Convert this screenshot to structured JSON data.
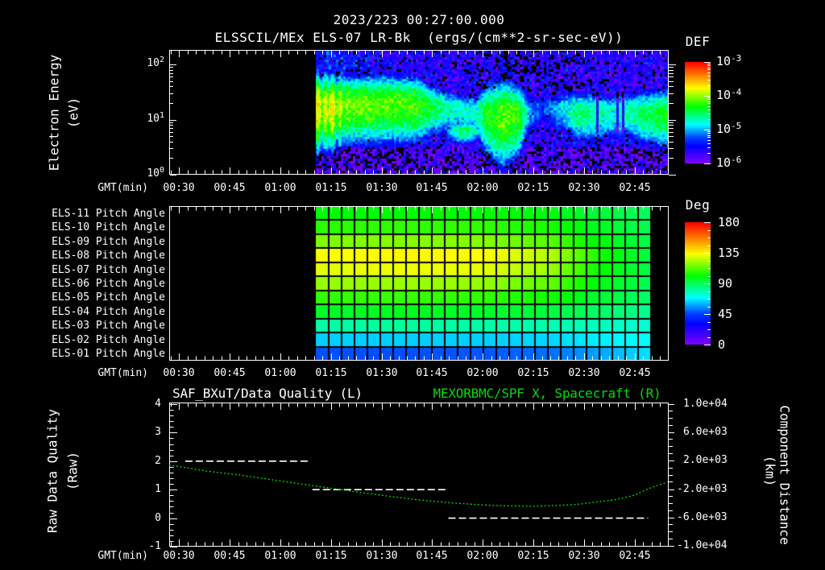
{
  "title": "2023/223 00:27:00.000",
  "subtitle": "ELSSCIL/MEx ELS-07 LR-Bk  (ergs/(cm**2-sr-sec-eV))",
  "colors": {
    "background": "#000000",
    "foreground": "#ffffff",
    "green": "#00dd00"
  },
  "time_axis": {
    "label": "GMT(min)",
    "tick_labels": [
      "00:30",
      "00:45",
      "01:00",
      "01:15",
      "01:30",
      "01:45",
      "02:00",
      "02:15",
      "02:30",
      "02:45"
    ],
    "start_min": 27,
    "end_min": 175.1,
    "major_step_min": 15,
    "minor_step_min": 2.5
  },
  "spectrogram_panel": {
    "ylabel": "Electron Energy",
    "ylabel_units": "(eV)",
    "ytick_exponents": [
      0,
      1,
      2
    ],
    "colorbar": {
      "title": "DEF",
      "tick_exponents": [
        -3,
        -4,
        -5,
        -6
      ]
    }
  },
  "pitch_panel": {
    "row_labels": [
      "ELS-11 Pitch Angle",
      "ELS-10 Pitch Angle",
      "ELS-09 Pitch Angle",
      "ELS-08 Pitch Angle",
      "ELS-07 Pitch Angle",
      "ELS-06 Pitch Angle",
      "ELS-05 Pitch Angle",
      "ELS-04 Pitch Angle",
      "ELS-03 Pitch Angle",
      "ELS-02 Pitch Angle",
      "ELS-01 Pitch Angle"
    ],
    "colorbar": {
      "title": "Deg",
      "ticks": [
        "180",
        "135",
        "90",
        "45",
        "0"
      ]
    }
  },
  "line_panel": {
    "title_left": "SAF_BXuT/Data Quality (L)",
    "title_right": "MEXORBMC/SPF X, Spacecraft (R)",
    "ylabel_left": "Raw Data Quality",
    "ylabel_left_units": "(Raw)",
    "yticks_left": [
      "4",
      "3",
      "2",
      "1",
      "0",
      "-1"
    ],
    "ylabel_right": "Component Distance",
    "ylabel_right_units": "(km)",
    "yticks_right": [
      "1.0e+04",
      "6.0e+03",
      "2.0e+03",
      "-2.0e+03",
      "-6.0e+03",
      "-1.0e+04"
    ]
  },
  "chart_data": [
    {
      "type": "heatmap",
      "name": "electron-energy-spectrogram",
      "x_unit": "GMT(min)",
      "x_range_min": [
        27,
        175.1
      ],
      "data_start_min": 70.5,
      "y_unit": "eV",
      "y_range": [
        1,
        180
      ],
      "y_scale": "log",
      "value_unit": "ergs/(cm**2-sr-sec-eV)",
      "value_range": [
        1e-06,
        0.001
      ],
      "value_scale": "log",
      "band_keyframes_t": [
        70.5,
        75,
        80,
        90,
        100,
        106,
        112,
        118,
        121,
        126,
        131,
        134,
        138,
        144,
        148,
        153,
        158,
        163,
        167,
        172,
        176
      ],
      "band_keyframes_logamp": [
        -3.85,
        -3.9,
        -4.1,
        -4.15,
        -4.2,
        -4.5,
        -4.75,
        -4.75,
        -4.35,
        -4.1,
        -4.25,
        -5.05,
        -5.3,
        -4.85,
        -4.55,
        -4.6,
        -4.75,
        -4.65,
        -4.5,
        -4.4,
        -4.35
      ],
      "band_keyframes_center_log_ev": [
        1.22,
        1.23,
        1.26,
        1.28,
        1.26,
        1.22,
        1.18,
        1.12,
        1.08,
        1.05,
        1.07,
        1.15,
        1.2,
        1.18,
        1.12,
        1.1,
        1.12,
        1.12,
        1.1,
        1.1,
        1.1
      ],
      "band_keyframes_width_log_ev": [
        0.5,
        0.5,
        0.46,
        0.48,
        0.46,
        0.36,
        0.32,
        0.32,
        0.52,
        0.6,
        0.5,
        0.34,
        0.3,
        0.34,
        0.38,
        0.38,
        0.35,
        0.35,
        0.38,
        0.42,
        0.45
      ],
      "low_blob": {
        "t_center_min": 114.5,
        "t_sigma_min": 6,
        "log_ev_center": 0.78,
        "log_ev_sigma": 0.22,
        "log_amp": -4.5
      },
      "notch_times_min": [
        154,
        159.9,
        161.7
      ]
    },
    {
      "type": "heatmap",
      "name": "pitch-angle-panels",
      "rows": [
        "ELS-11",
        "ELS-10",
        "ELS-09",
        "ELS-08",
        "ELS-07",
        "ELS-06",
        "ELS-05",
        "ELS-04",
        "ELS-03",
        "ELS-02",
        "ELS-01"
      ],
      "value_unit": "Deg",
      "value_range": [
        0,
        180
      ],
      "data_start_min": 70.5,
      "data_end_min": 169.9,
      "t_frac": [
        0,
        0.25,
        0.5,
        0.7,
        0.85,
        1
      ],
      "values_deg": [
        [
          100,
          101,
          101,
          99,
          93,
          89
        ],
        [
          106,
          107,
          107,
          104,
          96,
          90
        ],
        [
          117,
          118,
          118,
          112,
          99,
          91
        ],
        [
          133,
          135,
          134,
          124,
          103,
          92
        ],
        [
          130,
          132,
          131,
          121,
          101,
          91
        ],
        [
          120,
          121,
          120,
          113,
          98,
          90
        ],
        [
          107,
          108,
          107,
          103,
          94,
          87
        ],
        [
          96,
          97,
          96,
          93,
          88,
          82
        ],
        [
          80,
          81,
          80,
          79,
          77,
          74
        ],
        [
          63,
          63,
          63,
          64,
          67,
          70
        ],
        [
          47,
          47,
          48,
          51,
          58,
          66
        ]
      ],
      "n_time_cells": 26
    },
    {
      "type": "line",
      "name": "quality-and-spacecraft-distance",
      "ylim_left": [
        -1,
        4
      ],
      "ylim_right": [
        -10000,
        10000
      ],
      "series": [
        {
          "name": "SAF_BXuT/Data Quality",
          "axis": "left",
          "style": "white-dashed",
          "segments": [
            {
              "t_start_min": 31.8,
              "t_end_min": 69.0,
              "value": 2
            },
            {
              "t_start_min": 69.5,
              "t_end_min": 108.9,
              "value": 1
            },
            {
              "t_start_min": 109.8,
              "t_end_min": 169.0,
              "value": 0
            }
          ]
        },
        {
          "name": "MEXORBMC/SPF X Spacecraft",
          "axis": "right",
          "style": "green-dotted",
          "t_min": [
            27,
            38,
            48.5,
            60,
            72.4,
            85,
            98.7,
            111,
            123,
            135,
            147,
            159,
            165,
            169,
            172,
            174.8
          ],
          "km": [
            1350,
            500,
            -100,
            -900,
            -1750,
            -2600,
            -3450,
            -4000,
            -4350,
            -4460,
            -4240,
            -3560,
            -2900,
            -2010,
            -1500,
            -1070
          ]
        }
      ]
    }
  ]
}
